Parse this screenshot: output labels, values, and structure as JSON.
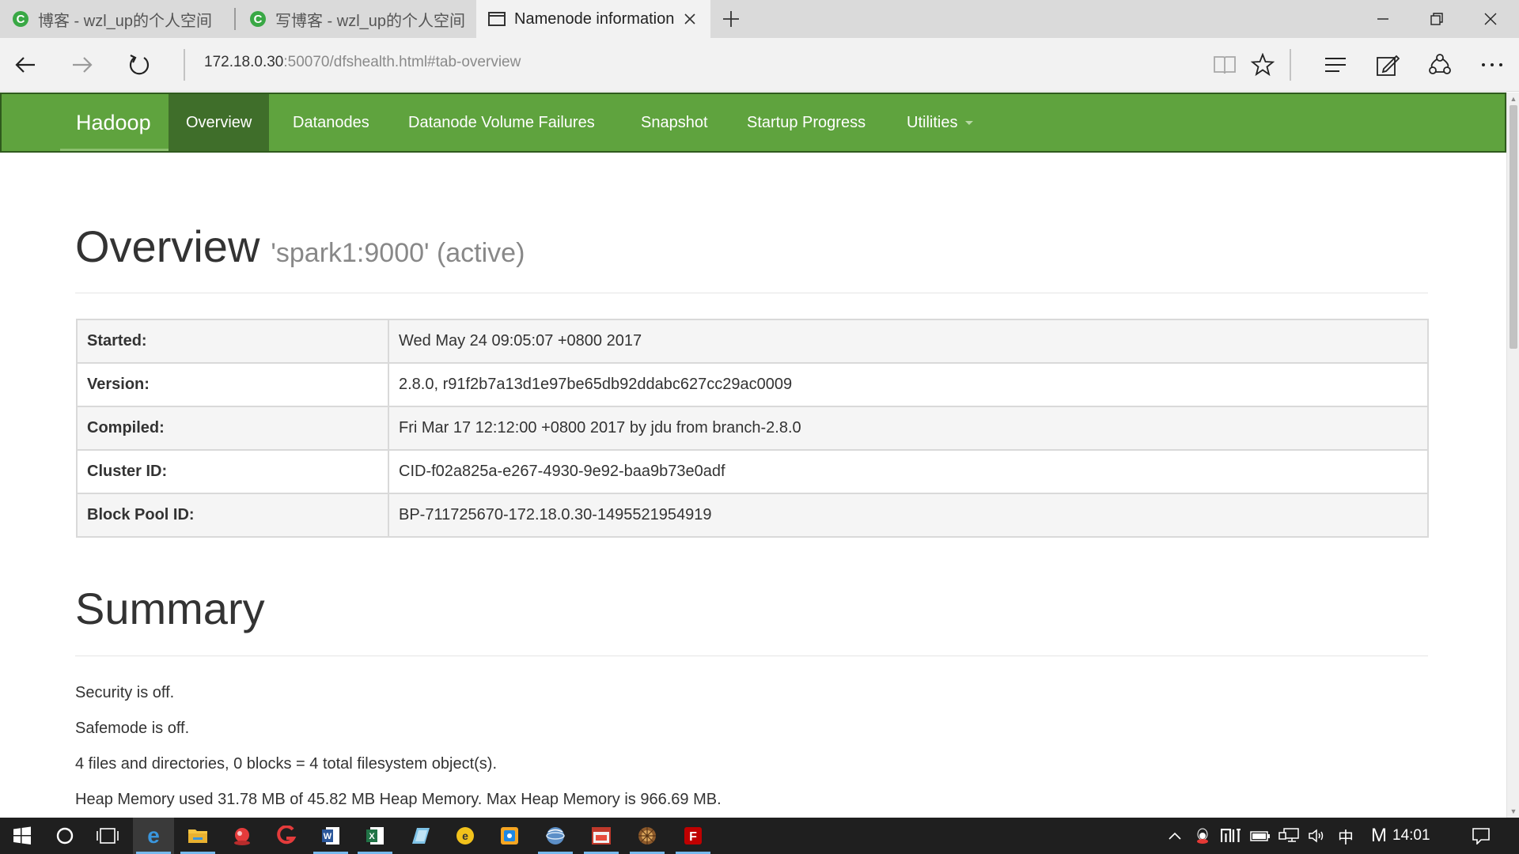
{
  "browser": {
    "tabs": [
      {
        "title": "博客 - wzl_up的个人空间",
        "icon": "csdn-icon",
        "active": false
      },
      {
        "title": "写博客 - wzl_up的个人空间",
        "icon": "csdn-icon",
        "active": false
      },
      {
        "title": "Namenode information",
        "icon": "page-icon",
        "active": true
      }
    ],
    "url": {
      "host": "172.18.0.30",
      "rest": ":50070/dfshealth.html#tab-overview"
    }
  },
  "hadoop_nav": {
    "brand": "Hadoop",
    "items": [
      {
        "label": "Overview",
        "active": true
      },
      {
        "label": "Datanodes",
        "active": false
      },
      {
        "label": "Datanode Volume Failures",
        "active": false
      },
      {
        "label": "Snapshot",
        "active": false
      },
      {
        "label": "Startup Progress",
        "active": false
      },
      {
        "label": "Utilities",
        "active": false,
        "dropdown": true
      }
    ]
  },
  "overview": {
    "title": "Overview",
    "subtitle": "'spark1:9000' (active)",
    "rows": [
      {
        "key": "Started:",
        "value": "Wed May 24 09:05:07 +0800 2017"
      },
      {
        "key": "Version:",
        "value": "2.8.0, r91f2b7a13d1e97be65db92ddabc627cc29ac0009"
      },
      {
        "key": "Compiled:",
        "value": "Fri Mar 17 12:12:00 +0800 2017 by jdu from branch-2.8.0"
      },
      {
        "key": "Cluster ID:",
        "value": "CID-f02a825a-e267-4930-9e92-baa9b73e0adf"
      },
      {
        "key": "Block Pool ID:",
        "value": "BP-711725670-172.18.0.30-1495521954919"
      }
    ]
  },
  "summary": {
    "title": "Summary",
    "lines": [
      "Security is off.",
      "Safemode is off.",
      "4 files and directories, 0 blocks = 4 total filesystem object(s).",
      "Heap Memory used 31.78 MB of 45.82 MB Heap Memory. Max Heap Memory is 966.69 MB."
    ]
  },
  "taskbar": {
    "ime_label": "中",
    "m_label": "M",
    "time": "14:01"
  },
  "colors": {
    "hadoop_green": "#5fa33e",
    "hadoop_green_active": "#3f6e2a",
    "taskbar": "#1f1f1f"
  }
}
